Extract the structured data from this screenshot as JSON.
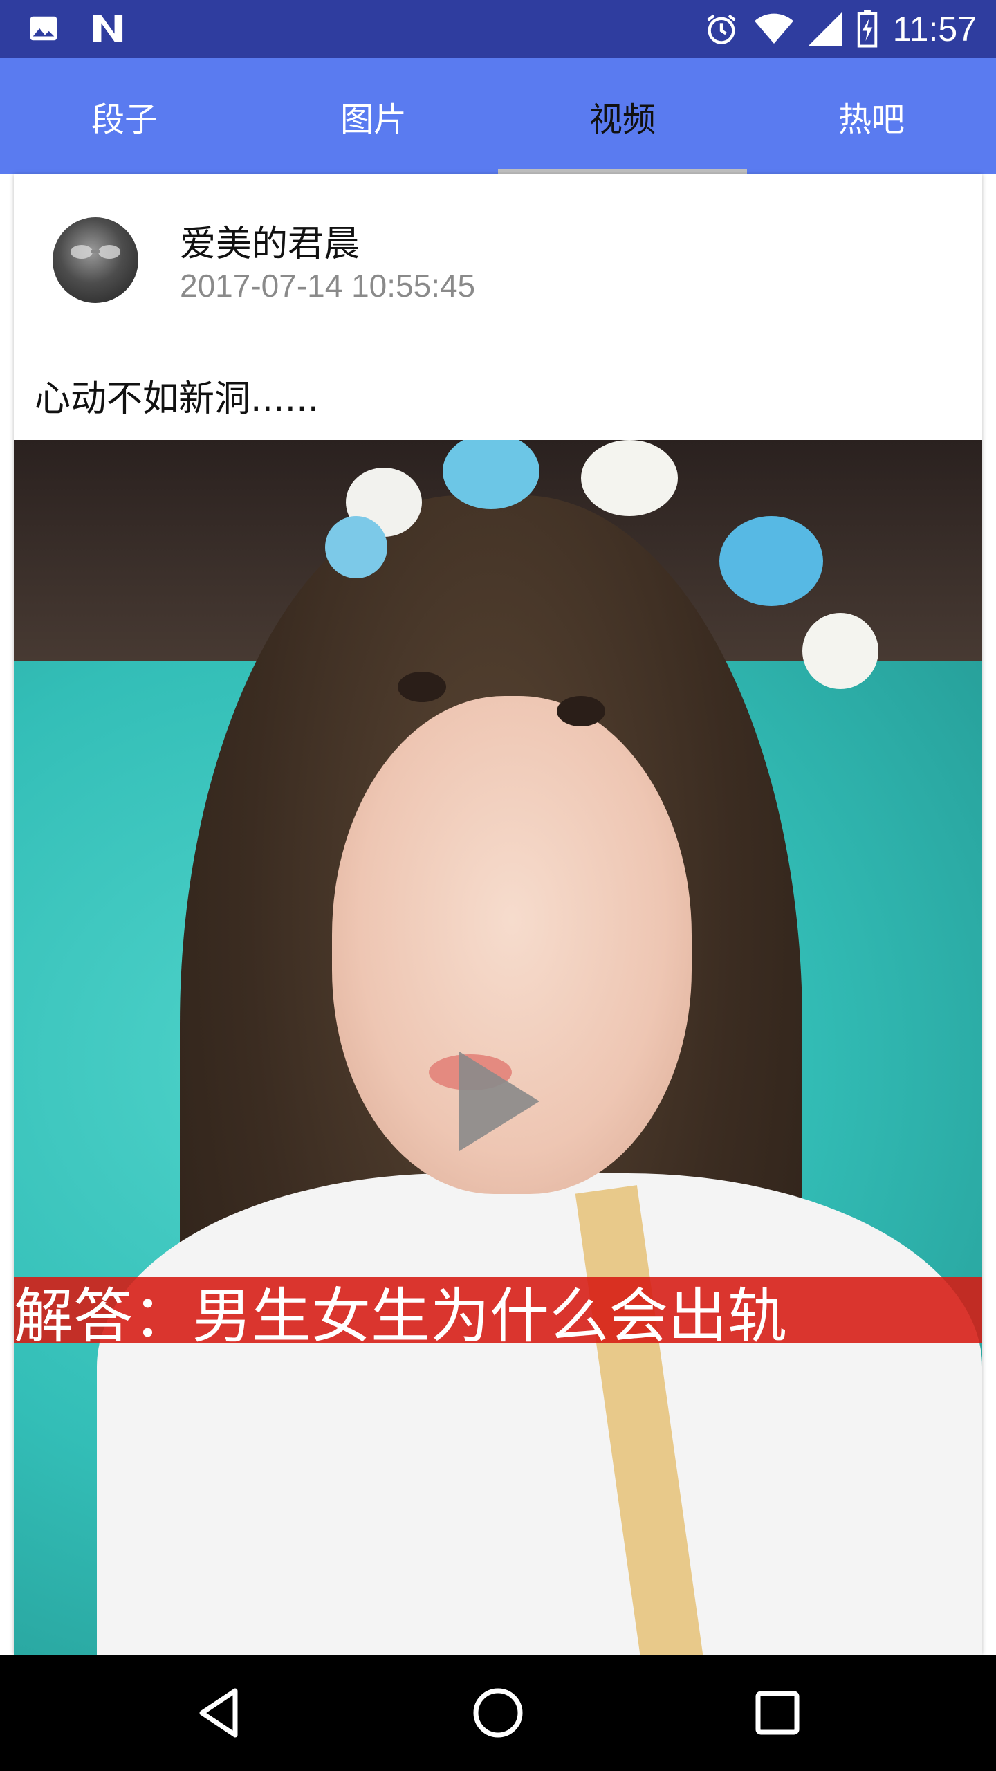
{
  "status_bar": {
    "time": "11:57",
    "left_icons": [
      "image-icon",
      "n-logo-icon"
    ],
    "right_icons": [
      "alarm-icon",
      "wifi-icon",
      "signal-icon",
      "battery-charging-icon"
    ]
  },
  "tabs": [
    {
      "label": "段子",
      "active": false
    },
    {
      "label": "图片",
      "active": false
    },
    {
      "label": "视频",
      "active": true
    },
    {
      "label": "热吧",
      "active": false
    }
  ],
  "post": {
    "username": "爱美的君晨",
    "timestamp": "2017-07-14 10:55:45",
    "text": "心动不如新洞......",
    "video": {
      "subtitle": "解答：男生女生为什么会出轨",
      "play_icon": "play-icon"
    }
  },
  "nav_bar": {
    "buttons": [
      "back-icon",
      "home-icon",
      "recents-icon"
    ]
  },
  "colors": {
    "status_bar": "#2f3d9f",
    "tab_bar": "#5a7bf0",
    "tab_indicator": "#bfbfbf",
    "subtitle_bar": "#d61a12"
  }
}
